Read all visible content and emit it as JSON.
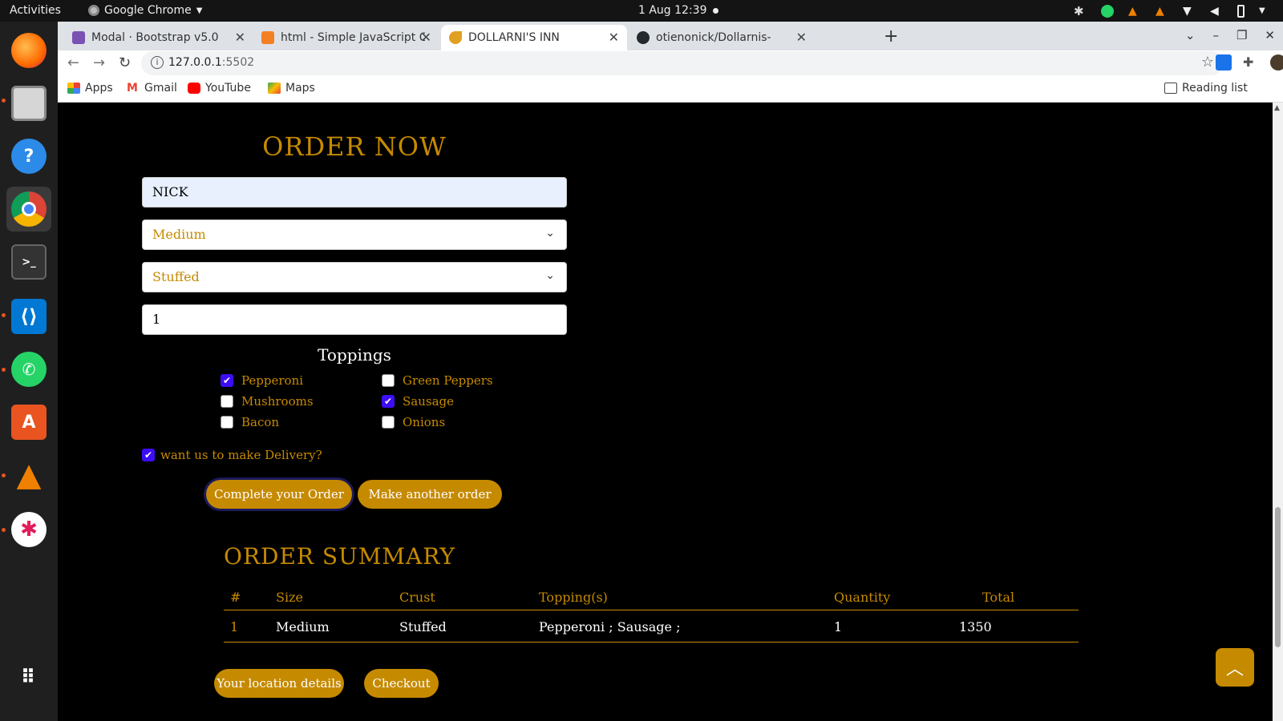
{
  "topbar": {
    "activities": "Activities",
    "app_name": "Google Chrome",
    "clock": "1 Aug  12:39"
  },
  "browser": {
    "tabs": [
      {
        "title": "Modal · Bootstrap v5.0",
        "favicon_color": "#7952b3"
      },
      {
        "title": "html - Simple JavaScript C",
        "favicon_color": "#f48024"
      },
      {
        "title": "DOLLARNI'S INN",
        "favicon_color": "#e0a020"
      },
      {
        "title": "otienonick/Dollarnis-",
        "favicon_color": "#24292e"
      }
    ],
    "url_host": "127.0.0.1",
    "url_port": ":5502",
    "bookmarks": [
      "Apps",
      "Gmail",
      "YouTube",
      "Maps"
    ],
    "reading_list": "Reading list"
  },
  "form": {
    "title": "ORDER NOW",
    "name_value": "NICK",
    "size_value": "Medium",
    "crust_value": "Stuffed",
    "quantity_value": "1",
    "toppings_label": "Toppings",
    "toppings": [
      {
        "label": "Pepperoni",
        "checked": true
      },
      {
        "label": "Mushrooms",
        "checked": false
      },
      {
        "label": "Bacon",
        "checked": false
      },
      {
        "label": "Green Peppers",
        "checked": false
      },
      {
        "label": "Sausage",
        "checked": true
      },
      {
        "label": "Onions",
        "checked": false
      }
    ],
    "delivery_label": "want us to make Delivery?",
    "delivery_checked": true,
    "complete_button": "Complete your Order",
    "another_button": "Make another order"
  },
  "summary": {
    "title": "ORDER SUMMARY",
    "headers": [
      "#",
      "Size",
      "Crust",
      "Topping(s)",
      "Quantity",
      "Total"
    ],
    "rows": [
      [
        "1",
        "Medium",
        "Stuffed",
        "Pepperoni ; Sausage ;",
        "1",
        "1350"
      ]
    ],
    "location_button": "Your location details",
    "checkout_button": "Checkout"
  },
  "colors": {
    "accent": "#c68a00",
    "checkbox": "#3d0df5",
    "background": "#000000"
  }
}
